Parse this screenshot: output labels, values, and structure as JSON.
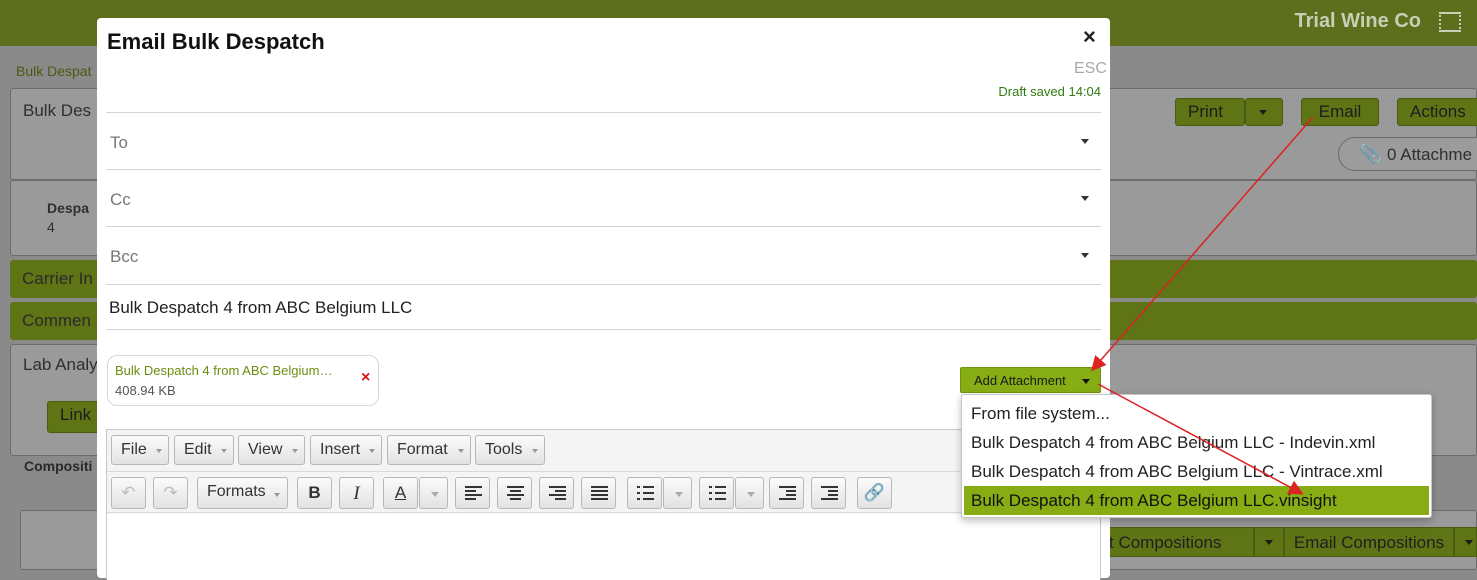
{
  "background": {
    "brand": "Trial Wine Co",
    "breadcrumb": "Bulk Despat",
    "panel_title": "Bulk Des",
    "despatch_label": "Despa",
    "despatch_value": "4",
    "buttons": {
      "print": "Print",
      "email": "Email",
      "actions": "Actions"
    },
    "attachments_pill": "0 Attachme",
    "sections": {
      "carrier": "Carrier In",
      "comments": "Commen",
      "lab": "Lab Analy",
      "link": "Link",
      "composition": "Compositi"
    },
    "bottom_buttons": {
      "import": "t Compositions",
      "email": "Email Compositions"
    }
  },
  "modal": {
    "title": "Email Bulk Despatch",
    "close": "×",
    "esc_hint": "ESC",
    "draft_status": "Draft saved 14:04",
    "fields": {
      "to": "To",
      "cc": "Cc",
      "bcc": "Bcc"
    },
    "subject": "Bulk Despatch 4 from ABC Belgium LLC",
    "attachment": {
      "name": "Bulk Despatch 4 from ABC Belgium LLC.vinsight",
      "size": "408.94 KB",
      "remove": "×"
    },
    "add_attachment": "Add Attachment",
    "dropdown": [
      "From file system...",
      "Bulk Despatch 4 from ABC Belgium LLC - Indevin.xml",
      "Bulk Despatch 4 from ABC Belgium LLC - Vintrace.xml",
      "Bulk Despatch 4 from ABC Belgium LLC.vinsight"
    ],
    "dropdown_selected_index": 3,
    "editor": {
      "menus": [
        "File",
        "Edit",
        "View",
        "Insert",
        "Format",
        "Tools"
      ],
      "formats_label": "Formats",
      "bold": "B",
      "italic": "I",
      "text_color": "A"
    }
  },
  "colors": {
    "accent": "#86ad14",
    "annotation_arrow": "#dd2222",
    "header_dim": "#5d6e1c"
  }
}
